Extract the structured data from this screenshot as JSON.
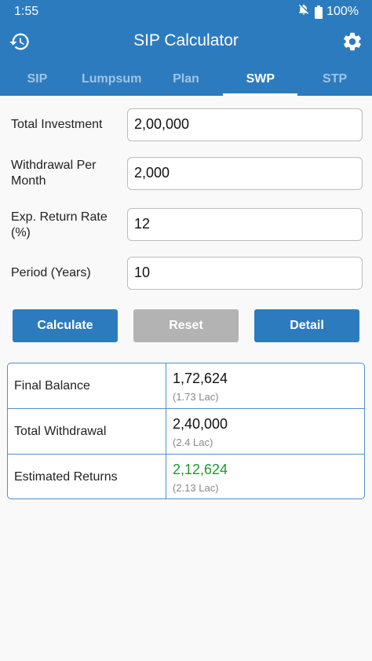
{
  "status_bar": {
    "time": "1:55",
    "battery": "100%"
  },
  "appbar": {
    "title": "SIP Calculator"
  },
  "tabs": [
    {
      "label": "SIP",
      "active": false
    },
    {
      "label": "Lumpsum",
      "active": false
    },
    {
      "label": "Plan",
      "active": false
    },
    {
      "label": "SWP",
      "active": true
    },
    {
      "label": "STP",
      "active": false
    }
  ],
  "form": {
    "total_investment": {
      "label": "Total Investment",
      "value": "2,00,000"
    },
    "withdrawal": {
      "label": "Withdrawal Per Month",
      "value": "2,000"
    },
    "return_rate": {
      "label": "Exp. Return Rate (%)",
      "value": "12"
    },
    "period": {
      "label": "Period (Years)",
      "value": "10"
    }
  },
  "buttons": {
    "calculate": "Calculate",
    "reset": "Reset",
    "detail": "Detail"
  },
  "results": {
    "final_balance": {
      "label": "Final Balance",
      "value": "1,72,624",
      "sub": "(1.73 Lac)"
    },
    "total_withdrawal": {
      "label": "Total Withdrawal",
      "value": "2,40,000",
      "sub": "(2.4 Lac)"
    },
    "estimated_returns": {
      "label": "Estimated Returns",
      "value": "2,12,624",
      "sub": "(2.13 Lac)"
    }
  },
  "colors": {
    "primary": "#2d7bbf",
    "reset": "#b3b3b3",
    "returns_green": "#1e9a2e"
  },
  "icons": [
    "history-icon",
    "settings-gear-icon",
    "notifications-off-icon",
    "battery-icon"
  ]
}
